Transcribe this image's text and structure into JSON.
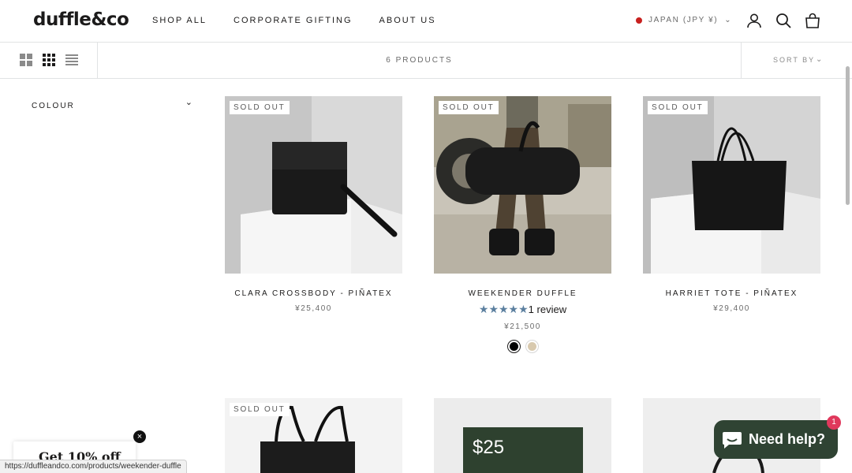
{
  "header": {
    "logo": "duffle&co",
    "nav": [
      "SHOP ALL",
      "CORPORATE GIFTING",
      "ABOUT US"
    ],
    "locale": "JAPAN (JPY ¥)",
    "icons": [
      "account-icon",
      "search-icon",
      "cart-icon"
    ]
  },
  "toolbar": {
    "product_count": "6 PRODUCTS",
    "sort_label": "SORT BY",
    "views": [
      "grid-large-icon",
      "grid-small-icon",
      "list-icon"
    ]
  },
  "filter": {
    "label": "COLOUR"
  },
  "products": [
    {
      "name": "CLARA CROSSBODY - PIÑATEX",
      "price": "¥25,400",
      "badge": "SOLD OUT"
    },
    {
      "name": "WEEKENDER DUFFLE",
      "price": "¥21,500",
      "badge": "SOLD OUT",
      "stars": "★★★★★",
      "rating": 5,
      "reviews": "1 review",
      "swatches": [
        "#000000",
        "#d8c9ae"
      ]
    },
    {
      "name": "HARRIET TOTE - PIÑATEX",
      "price": "¥29,400",
      "badge": "SOLD OUT"
    },
    {
      "name": "",
      "price": "",
      "badge": "SOLD OUT"
    },
    {
      "name": "",
      "price": "",
      "gift_value": "$25"
    },
    {
      "name": "",
      "price": ""
    }
  ],
  "popups": {
    "promo": "Get 10% off",
    "close": "×",
    "status_url": "https://duffleandco.com/products/weekender-duffle",
    "help": "Need help?",
    "help_badge": "1"
  },
  "colors": {
    "accent": "#5b7f9f",
    "sold_out_dot": "#c8201e",
    "help_bg": "#2f4333"
  }
}
